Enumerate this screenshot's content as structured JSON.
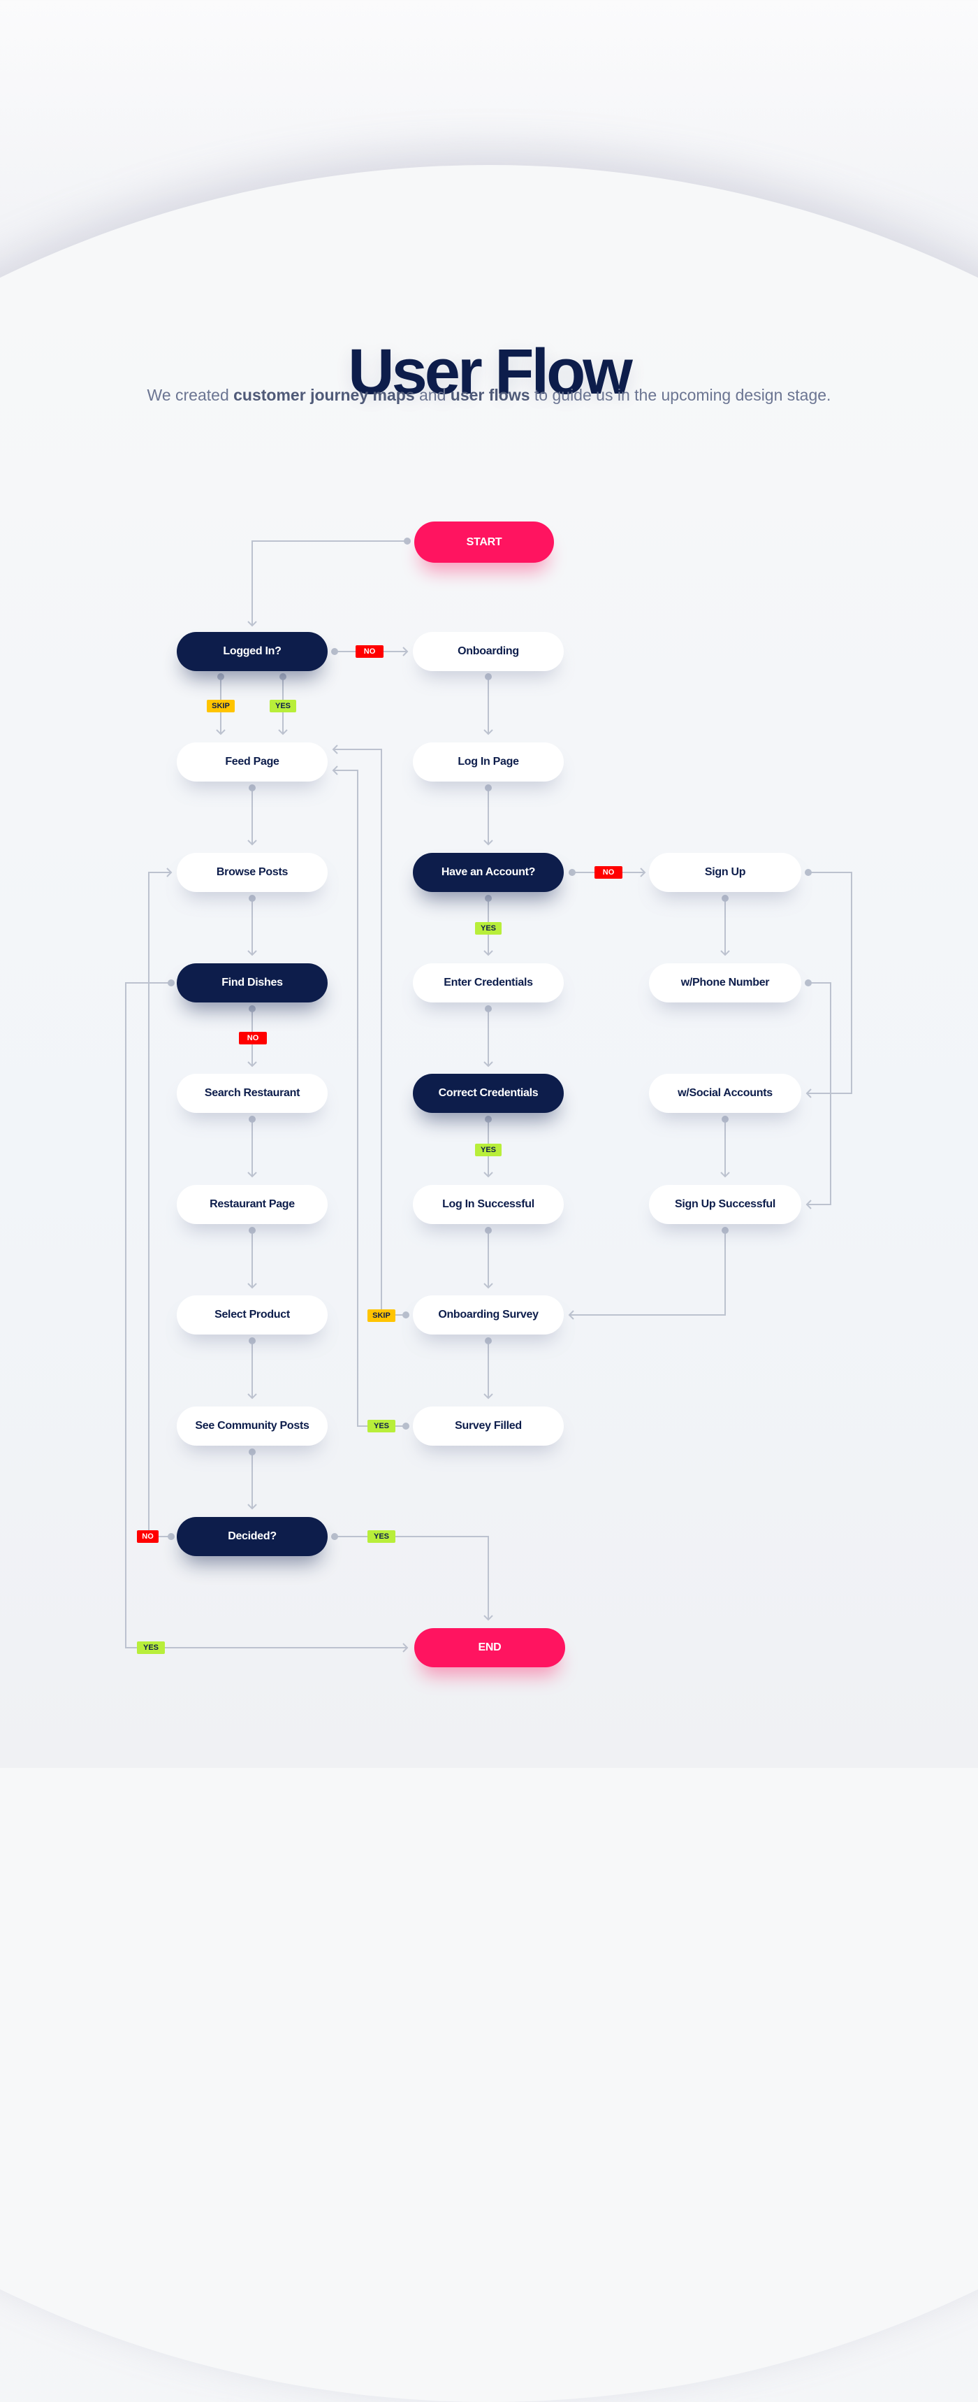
{
  "header": {
    "title": "User Flow",
    "subtitle_parts": [
      {
        "text": "We created ",
        "bold": false
      },
      {
        "text": "customer journey maps",
        "bold": true
      },
      {
        "text": " and ",
        "bold": false
      },
      {
        "text": "user flows",
        "bold": true
      },
      {
        "text": " to guide us in the upcoming design stage.",
        "bold": false
      }
    ]
  },
  "colors": {
    "navy": "#0d1d4b",
    "accent": "#ff1460",
    "connector": "#bcc2cf",
    "badge_no": "#ff0000",
    "badge_yes": "#b8ee3a",
    "badge_skip": "#ffc400"
  },
  "nodes": {
    "start": {
      "label": "START",
      "kind": "terminal"
    },
    "logged_in": {
      "label": "Logged In?",
      "kind": "decision"
    },
    "onboarding": {
      "label": "Onboarding",
      "kind": "step"
    },
    "feed_page": {
      "label": "Feed Page",
      "kind": "step"
    },
    "log_in_page": {
      "label": "Log In Page",
      "kind": "step"
    },
    "browse_posts": {
      "label": "Browse Posts",
      "kind": "step"
    },
    "have_account": {
      "label": "Have an Account?",
      "kind": "decision"
    },
    "sign_up": {
      "label": "Sign Up",
      "kind": "step"
    },
    "find_dishes": {
      "label": "Find Dishes",
      "kind": "decision"
    },
    "enter_credentials": {
      "label": "Enter Credentials",
      "kind": "step"
    },
    "phone_number": {
      "label": "w/Phone Number",
      "kind": "step"
    },
    "search_restaurant": {
      "label": "Search Restaurant",
      "kind": "step"
    },
    "correct_credentials": {
      "label": "Correct Credentials",
      "kind": "decision"
    },
    "social_accounts": {
      "label": "w/Social Accounts",
      "kind": "step"
    },
    "restaurant_page": {
      "label": "Restaurant Page",
      "kind": "step"
    },
    "log_in_successful": {
      "label": "Log In Successful",
      "kind": "step"
    },
    "sign_up_successful": {
      "label": "Sign Up Successful",
      "kind": "step"
    },
    "select_product": {
      "label": "Select Product",
      "kind": "step"
    },
    "onboarding_survey": {
      "label": "Onboarding Survey",
      "kind": "step"
    },
    "community_posts": {
      "label": "See Community Posts",
      "kind": "step"
    },
    "survey_filled": {
      "label": "Survey Filled",
      "kind": "step"
    },
    "decided": {
      "label": "Decided?",
      "kind": "decision"
    },
    "end": {
      "label": "END",
      "kind": "terminal"
    }
  },
  "edges": [
    {
      "from": "start",
      "to": "logged_in",
      "label": ""
    },
    {
      "from": "logged_in",
      "to": "onboarding",
      "label": "NO"
    },
    {
      "from": "logged_in",
      "to": "feed_page",
      "label": "SKIP"
    },
    {
      "from": "logged_in",
      "to": "feed_page",
      "label": "YES"
    },
    {
      "from": "onboarding",
      "to": "log_in_page",
      "label": ""
    },
    {
      "from": "feed_page",
      "to": "browse_posts",
      "label": ""
    },
    {
      "from": "log_in_page",
      "to": "have_account",
      "label": ""
    },
    {
      "from": "have_account",
      "to": "sign_up",
      "label": "NO"
    },
    {
      "from": "have_account",
      "to": "enter_credentials",
      "label": "YES"
    },
    {
      "from": "browse_posts",
      "to": "find_dishes",
      "label": ""
    },
    {
      "from": "find_dishes",
      "to": "search_restaurant",
      "label": "NO"
    },
    {
      "from": "find_dishes",
      "to": "end",
      "label": "YES"
    },
    {
      "from": "sign_up",
      "to": "phone_number",
      "label": ""
    },
    {
      "from": "sign_up",
      "to": "social_accounts",
      "label": ""
    },
    {
      "from": "phone_number",
      "to": "sign_up_successful",
      "label": ""
    },
    {
      "from": "enter_credentials",
      "to": "correct_credentials",
      "label": ""
    },
    {
      "from": "correct_credentials",
      "to": "log_in_successful",
      "label": "YES"
    },
    {
      "from": "social_accounts",
      "to": "sign_up_successful",
      "label": ""
    },
    {
      "from": "search_restaurant",
      "to": "restaurant_page",
      "label": ""
    },
    {
      "from": "log_in_successful",
      "to": "onboarding_survey",
      "label": ""
    },
    {
      "from": "sign_up_successful",
      "to": "onboarding_survey",
      "label": ""
    },
    {
      "from": "restaurant_page",
      "to": "select_product",
      "label": ""
    },
    {
      "from": "onboarding_survey",
      "to": "survey_filled",
      "label": ""
    },
    {
      "from": "onboarding_survey",
      "to": "feed_page",
      "label": "SKIP"
    },
    {
      "from": "survey_filled",
      "to": "feed_page",
      "label": "YES"
    },
    {
      "from": "select_product",
      "to": "community_posts",
      "label": ""
    },
    {
      "from": "community_posts",
      "to": "decided",
      "label": ""
    },
    {
      "from": "decided",
      "to": "end",
      "label": "YES"
    },
    {
      "from": "decided",
      "to": "browse_posts",
      "label": "NO"
    }
  ],
  "badges": {
    "logged_in_no": "NO",
    "logged_in_skip": "SKIP",
    "logged_in_yes": "YES",
    "have_account_no": "NO",
    "have_account_yes": "YES",
    "find_dishes_no": "NO",
    "correct_credentials_yes": "YES",
    "survey_skip": "SKIP",
    "survey_yes": "YES",
    "decided_no": "NO",
    "decided_yes": "YES",
    "find_dishes_yes": "YES"
  }
}
